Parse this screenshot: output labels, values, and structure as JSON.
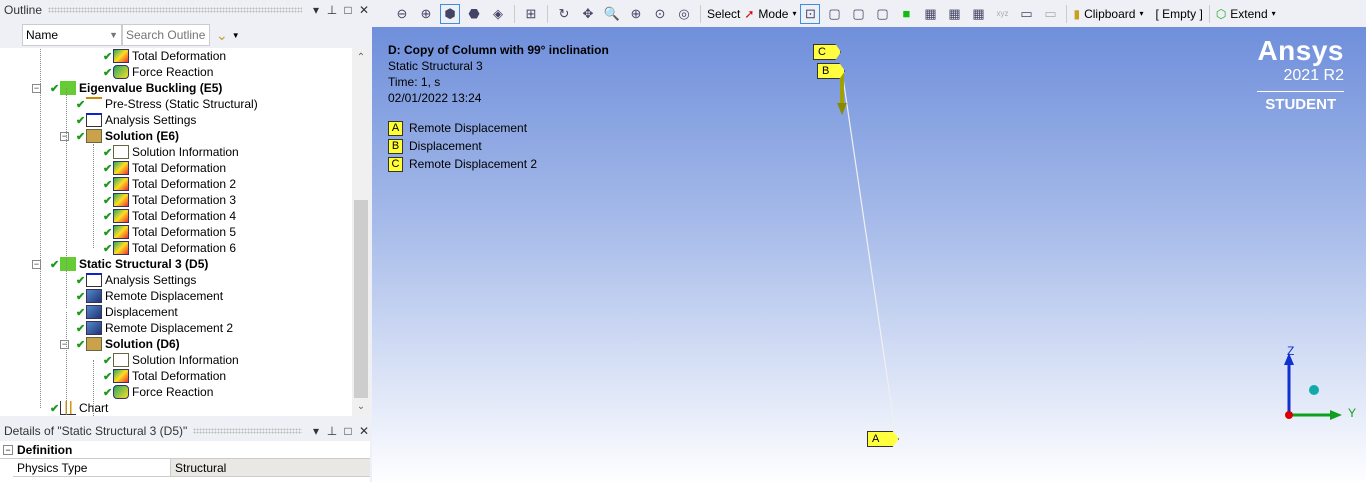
{
  "outline": {
    "title": "Outline",
    "filter_value": "Name",
    "search_placeholder": "Search Outline",
    "items": [
      {
        "label": "Total Deformation",
        "level": 3,
        "bold": false,
        "icon": "result-icon",
        "exp": false
      },
      {
        "label": "Force Reaction",
        "level": 3,
        "bold": false,
        "icon": "probe-icon",
        "exp": false
      },
      {
        "label": "Eigenvalue Buckling (E5)",
        "level": 1,
        "bold": true,
        "icon": "analysis-icon",
        "exp": true
      },
      {
        "label": "Pre-Stress (Static Structural)",
        "level": 2,
        "bold": false,
        "icon": "prestress-icon",
        "exp": false
      },
      {
        "label": "Analysis Settings",
        "level": 2,
        "bold": false,
        "icon": "settings-icon",
        "exp": false
      },
      {
        "label": "Solution (E6)",
        "level": 2,
        "bold": true,
        "icon": "solution-icon",
        "exp": true
      },
      {
        "label": "Solution Information",
        "level": 3,
        "bold": false,
        "icon": "info-icon",
        "exp": false
      },
      {
        "label": "Total Deformation",
        "level": 3,
        "bold": false,
        "icon": "result-icon",
        "exp": false
      },
      {
        "label": "Total Deformation 2",
        "level": 3,
        "bold": false,
        "icon": "result-icon",
        "exp": false
      },
      {
        "label": "Total Deformation 3",
        "level": 3,
        "bold": false,
        "icon": "result-icon",
        "exp": false
      },
      {
        "label": "Total Deformation 4",
        "level": 3,
        "bold": false,
        "icon": "result-icon",
        "exp": false
      },
      {
        "label": "Total Deformation 5",
        "level": 3,
        "bold": false,
        "icon": "result-icon",
        "exp": false
      },
      {
        "label": "Total Deformation 6",
        "level": 3,
        "bold": false,
        "icon": "result-icon",
        "exp": false
      },
      {
        "label": "Static Structural 3 (D5)",
        "level": 1,
        "bold": true,
        "icon": "analysis-icon",
        "exp": true
      },
      {
        "label": "Analysis Settings",
        "level": 2,
        "bold": false,
        "icon": "settings-icon",
        "exp": false
      },
      {
        "label": "Remote Displacement",
        "level": 2,
        "bold": false,
        "icon": "bc-icon",
        "exp": false
      },
      {
        "label": "Displacement",
        "level": 2,
        "bold": false,
        "icon": "bc-icon",
        "exp": false
      },
      {
        "label": "Remote Displacement 2",
        "level": 2,
        "bold": false,
        "icon": "bc-icon",
        "exp": false
      },
      {
        "label": "Solution (D6)",
        "level": 2,
        "bold": true,
        "icon": "solution-icon",
        "exp": true
      },
      {
        "label": "Solution Information",
        "level": 3,
        "bold": false,
        "icon": "info-icon",
        "exp": false
      },
      {
        "label": "Total Deformation",
        "level": 3,
        "bold": false,
        "icon": "result-icon",
        "exp": false
      },
      {
        "label": "Force Reaction",
        "level": 3,
        "bold": false,
        "icon": "probe-icon",
        "exp": false
      },
      {
        "label": "Chart",
        "level": 1,
        "bold": false,
        "icon": "chart-icon",
        "exp": false
      }
    ]
  },
  "details": {
    "title": "Details of \"Static Structural 3 (D5)\"",
    "section": "Definition",
    "rows": [
      {
        "name": "Physics Type",
        "value": "Structural"
      }
    ]
  },
  "toolbar": {
    "select": "Select",
    "mode": "Mode",
    "clipboard": "Clipboard",
    "empty": "[ Empty ]",
    "extend": "Extend"
  },
  "viewport": {
    "title": "D: Copy of Column with 99° inclination",
    "subtitle": "Static Structural 3",
    "time": "Time: 1, s",
    "date": "02/01/2022 13:24",
    "legend": [
      {
        "tag": "A",
        "label": "Remote Displacement"
      },
      {
        "tag": "B",
        "label": "Displacement"
      },
      {
        "tag": "C",
        "label": "Remote Displacement 2"
      }
    ],
    "brand": {
      "logo": "Ansys",
      "version": "2021 R2",
      "edition": "STUDENT"
    },
    "axes": {
      "z": "Z",
      "y": "Y"
    }
  },
  "colors": {
    "accent": "#3b8ee0",
    "tag": "#ffff33",
    "check": "#1a9a1a"
  }
}
